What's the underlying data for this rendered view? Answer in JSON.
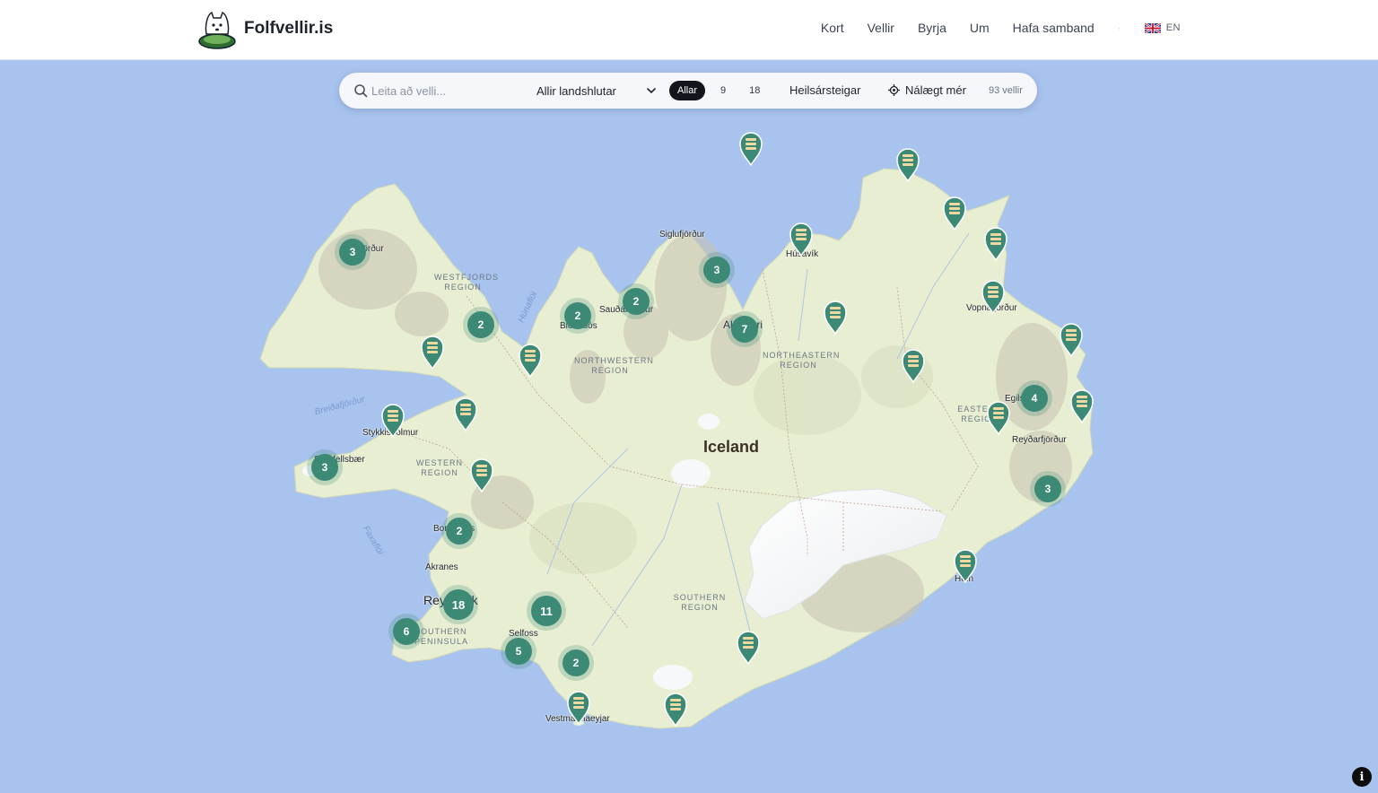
{
  "header": {
    "brand": "Folfvellir.is",
    "nav": [
      {
        "id": "kort",
        "label": "Kort"
      },
      {
        "id": "vellir",
        "label": "Vellir"
      },
      {
        "id": "byrja",
        "label": "Byrja"
      },
      {
        "id": "um",
        "label": "Um"
      },
      {
        "id": "hafa",
        "label": "Hafa samband"
      }
    ],
    "separator": "·",
    "language": {
      "code": "EN",
      "flag_icon": "uk-flag-icon"
    }
  },
  "filters": {
    "search_placeholder": "Leita að velli...",
    "region_select": "Allir landshlutar",
    "segments": [
      "Allar",
      "9",
      "18"
    ],
    "active_segment": "Allar",
    "year_round": "Heilsársteigar",
    "near_me": "Nálægt mér",
    "count": "93 vellir"
  },
  "map": {
    "country": "Iceland",
    "places": {
      "siglufjordur": "Siglufjörður",
      "husavik": "Húsavík",
      "vopnafjordur": "Vopnafjörður",
      "saudarkrokur": "Sauðárkrókur",
      "blonduos": "Blönduós",
      "akureyri": "Akureyri",
      "isafjordur": "Ísafjörður",
      "stykkisholmur": "Stykkishólmur",
      "snaefellsbaer": "Snæfellsbær",
      "borgarnes": "Borgarnes",
      "akranes": "Akranes",
      "reykjavik": "Reykjavík",
      "selfoss": "Selfoss",
      "vestmannaeyjar": "Vestmannaeyjar",
      "egilsstadir": "Egilsstaðir",
      "reydarfjordur": "Reyðarfjörður",
      "hofn": "Höfn"
    },
    "regions": {
      "westfjords": "Westfjords Region",
      "northwestern": "Northwestern Region",
      "northeastern": "Northeastern Region",
      "eastern": "Eastern Region",
      "western": "Western Region",
      "southern": "Southern Region",
      "southern_peninsula": "Southern Peninsula"
    },
    "water": {
      "hunafloi": "Húnaflói",
      "breidafjordur": "Breiðafjörður",
      "faxafloi": "Faxaflói"
    },
    "clusters": [
      "3",
      "2",
      "2",
      "2",
      "3",
      "7",
      "4",
      "3",
      "3",
      "2",
      "18",
      "11",
      "6",
      "5",
      "2"
    ],
    "single_courses": 22
  },
  "controls": {
    "info": "i"
  },
  "colors": {
    "marker": "#3c8a76",
    "water": "#a8c3ee",
    "land": "#e9efd4",
    "active_pill": "#12161c"
  }
}
